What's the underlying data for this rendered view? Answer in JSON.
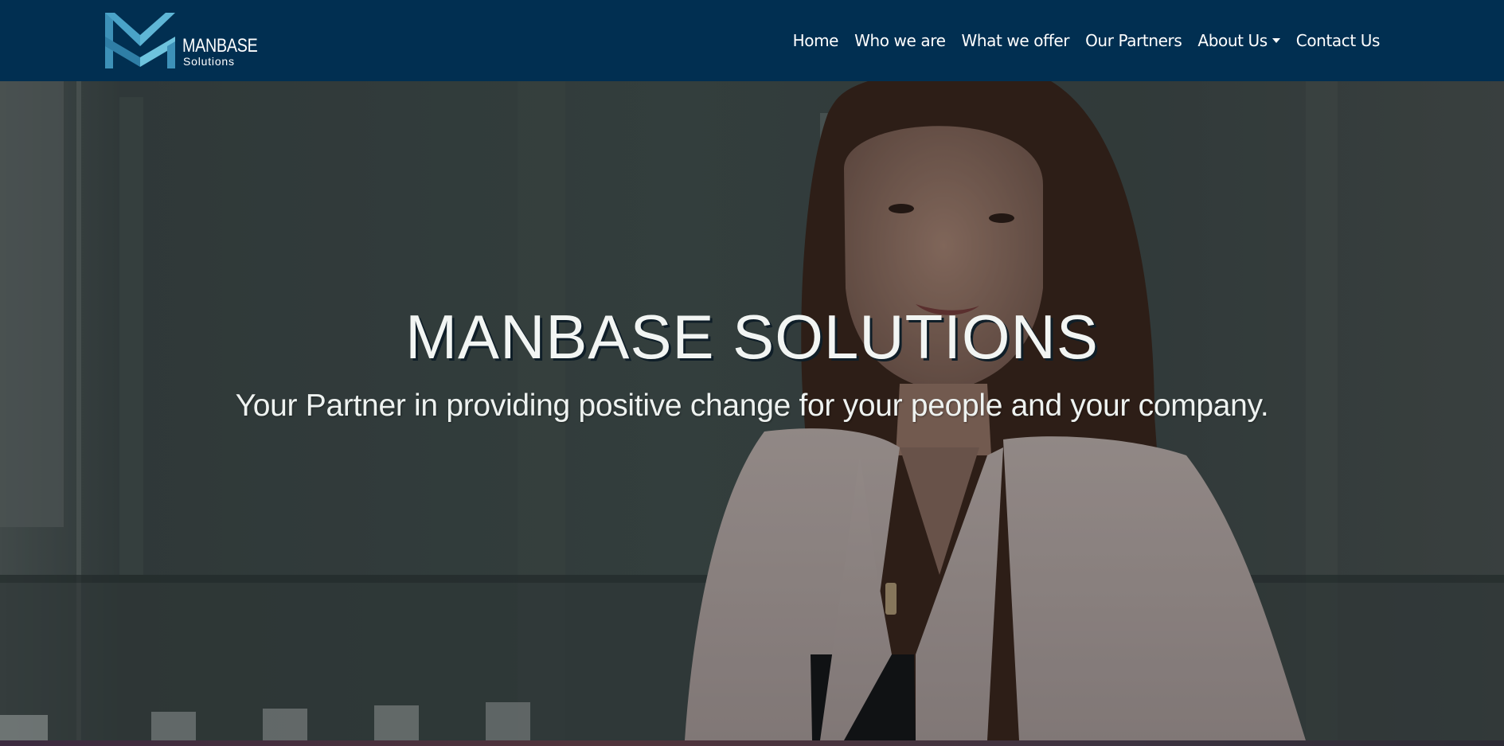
{
  "navbar": {
    "background": "#012f51",
    "logo": {
      "name": "MANBASE",
      "tagline": "Solutions",
      "colors": [
        "#3d91b8",
        "#6ec3dd",
        "#1f6e94"
      ]
    },
    "items": [
      {
        "label": "Home"
      },
      {
        "label": "Who we are"
      },
      {
        "label": "What we offer"
      },
      {
        "label": "Our Partners"
      },
      {
        "label": "About Us",
        "dropdown": true
      },
      {
        "label": "Contact Us"
      }
    ]
  },
  "hero": {
    "title": "MANBASE SOLUTIONS",
    "subtitle": "Your Partner in providing positive change for your people and your company.",
    "background_icon": "office-woman-photo"
  }
}
